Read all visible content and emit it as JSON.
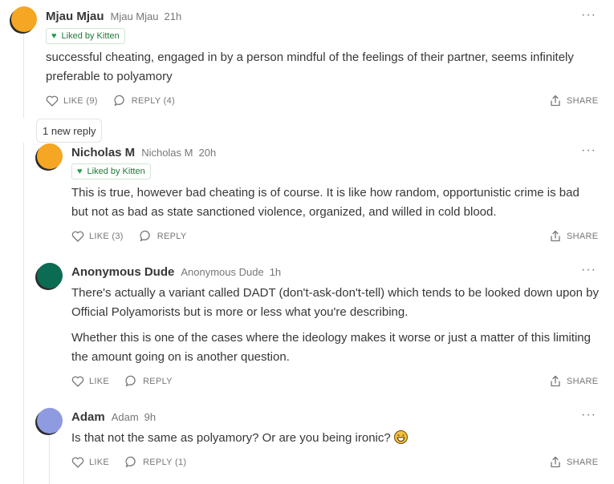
{
  "new_reply_label": "1 new reply",
  "colors": {
    "accent_green": "#26a04a",
    "text": "#363737",
    "muted": "#777777"
  },
  "comments": [
    {
      "name": "Mjau Mjau",
      "handle": "Mjau Mjau",
      "time": "21h",
      "liked_by": "Liked by Kitten",
      "paragraphs": [
        "successful cheating, engaged in by a person mindful of the feelings of their partner, seems infinitely preferable to polyamory"
      ],
      "like_label": "LIKE (9)",
      "reply_label": "REPLY (4)",
      "share_label": "SHARE",
      "avatar_color": "#f5a623"
    },
    {
      "name": "Nicholas M",
      "handle": "Nicholas M",
      "time": "20h",
      "liked_by": "Liked by Kitten",
      "paragraphs": [
        "This is true, however bad cheating is of course. It is like how random, opportunistic crime is bad but not as bad as state sanctioned violence, organized, and willed in cold blood."
      ],
      "like_label": "LIKE (3)",
      "reply_label": "REPLY",
      "share_label": "SHARE",
      "avatar_color": "#f5a623"
    },
    {
      "name": "Anonymous Dude",
      "handle": "Anonymous Dude",
      "time": "1h",
      "paragraphs": [
        "There's actually a variant called DADT (don't-ask-don't-tell) which tends to be looked down upon by Official Polyamorists but is more or less what you're describing.",
        "Whether this is one of the cases where the ideology makes it worse or just a matter of this limiting the amount going on is another question."
      ],
      "like_label": "LIKE",
      "reply_label": "REPLY",
      "share_label": "SHARE",
      "avatar_color": "#0b6b53"
    },
    {
      "name": "Adam",
      "handle": "Adam",
      "time": "9h",
      "paragraphs": [
        "Is that not the same as polyamory? Or are you being ironic?"
      ],
      "emoji": "grinning-face",
      "like_label": "LIKE",
      "reply_label": "REPLY (1)",
      "share_label": "SHARE",
      "avatar_color": "#8e9be0"
    }
  ]
}
